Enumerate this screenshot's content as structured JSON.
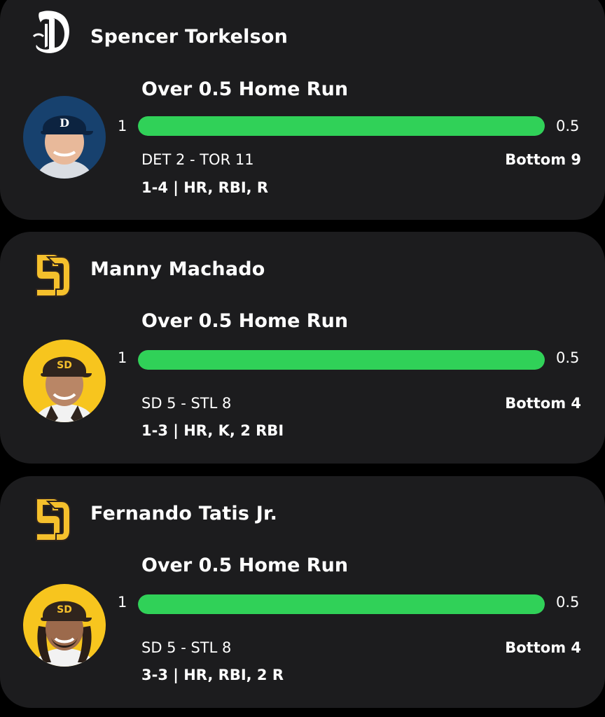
{
  "cards": [
    {
      "team_logo": "tigers-old-english-d-logo",
      "player": "Spencer Torkelson",
      "prop": "Over 0.5 Home Run",
      "actual": "1",
      "line": "0.5",
      "progress": 1.0,
      "score": "DET 2 - TOR 11",
      "inning": "Bottom 9",
      "statline": "1-4 | HR, RBI, R",
      "avatar_bg": "#17416e"
    },
    {
      "team_logo": "padres-sd-logo",
      "player": "Manny Machado",
      "prop": "Over 0.5 Home Run",
      "actual": "1",
      "line": "0.5",
      "progress": 1.0,
      "score": "SD 5 - STL 8",
      "inning": "Bottom 4",
      "statline": "1-3 | HR, K, 2 RBI",
      "avatar_bg": "#f7c51e"
    },
    {
      "team_logo": "padres-sd-logo",
      "player": "Fernando Tatis Jr.",
      "prop": "Over 0.5 Home Run",
      "actual": "1",
      "line": "0.5",
      "progress": 1.0,
      "score": "SD 5 - STL 8",
      "inning": "Bottom 4",
      "statline": "3-3 | HR, RBI, 2 R",
      "avatar_bg": "#f7c51e"
    }
  ],
  "colors": {
    "progress_fill": "#30d158",
    "card_bg": "#1c1c1e",
    "padres_gold": "#f5c02c",
    "padres_brown": "#2f241d"
  }
}
